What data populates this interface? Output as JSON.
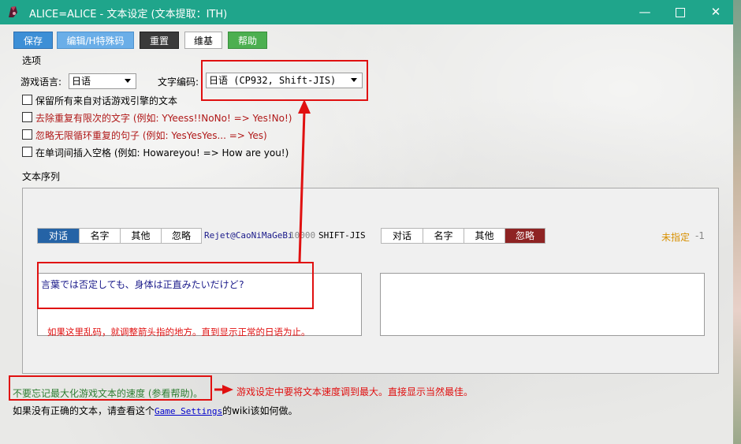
{
  "window": {
    "title": "ALICE=ALICE - 文本设定 (文本提取：ITH)",
    "controls": [
      "minimize",
      "maximize",
      "close"
    ]
  },
  "toolbar": {
    "save": "保存",
    "edit_special": "编辑/H特殊码",
    "reset": "重置",
    "wiki": "维基",
    "help": "帮助"
  },
  "options": {
    "group_label": "选项",
    "game_language_label": "游戏语言:",
    "game_language_value": "日语",
    "encoding_label": "文字编码:",
    "encoding_value": "日语 (CP932, Shift-JIS)",
    "checkboxes": [
      {
        "label": "保留所有来自对话游戏引擎的文本",
        "checked": false,
        "color": "#000000"
      },
      {
        "label": "去除重复有限次的文字 (例如: YYeess!!NoNo! => Yes!No!)",
        "checked": false,
        "color": "#b01818"
      },
      {
        "label": "忽略无限循环重复的句子 (例如: YesYesYes... => Yes)",
        "checked": false,
        "color": "#b01818"
      },
      {
        "label": "在单词间插入空格 (例如: Howareyou! => How are you!)",
        "checked": false,
        "color": "#000000"
      }
    ]
  },
  "sequence": {
    "label": "文本序列",
    "left": {
      "tabs": [
        "对话",
        "名字",
        "其他",
        "忽略"
      ],
      "active": 0,
      "signature": "Rejet@CaoNiMaGeBi",
      "number": "10000",
      "encoding": "SHIFT-JIS",
      "text": "言葉では否定しても、身体は正直みたいだけど?"
    },
    "right": {
      "tabs": [
        "对话",
        "名字",
        "其他",
        "忽略"
      ],
      "active": 3,
      "status": "未指定",
      "index": "-1",
      "text": ""
    }
  },
  "annotations": {
    "garbled_hint": "如果这里乱码，就调整箭头指的地方。直到显示正常的日语为止。",
    "speed_tip": "不要忘记最大化游戏文本的速度 (参看帮助)。",
    "speed_note": "游戏设定中要将文本速度调到最大。直接显示当然最佳。",
    "footer_before": "如果没有正确的文本，请查看这个",
    "footer_link": "Game Settings",
    "footer_after": "的wiki该如何做。"
  },
  "colors": {
    "titlebar": "#1fa58b",
    "save_button": "#3d8fd6",
    "edit_button": "#6aaee8",
    "reset_button": "#3a3a3a",
    "help_button": "#4caf50",
    "active_tab_left": "#2563a6",
    "active_tab_right": "#8e2323",
    "annotation_red": "#e01010",
    "tip_green": "#2e7d32",
    "status_orange": "#d89000"
  }
}
